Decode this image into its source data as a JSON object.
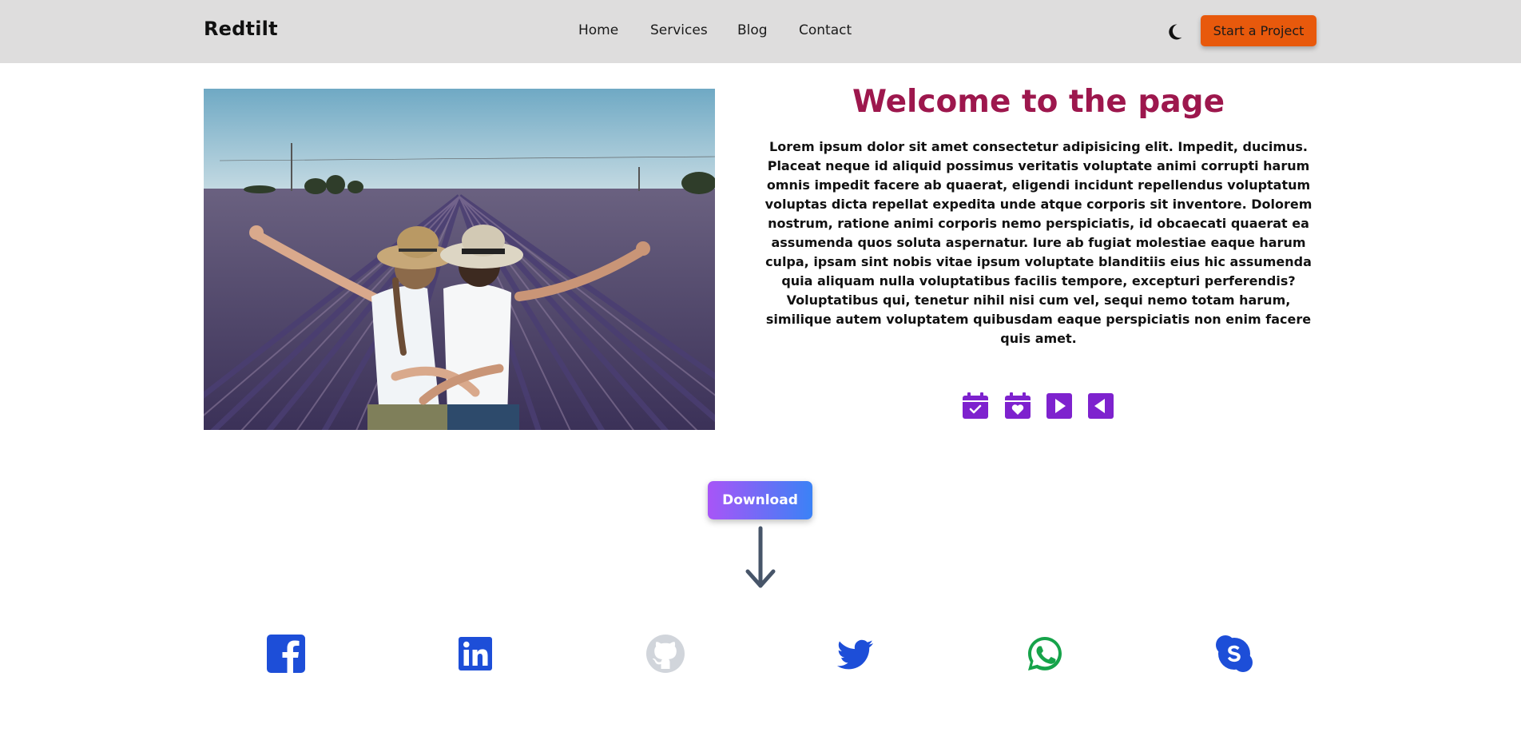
{
  "header": {
    "brand": "Redtilt",
    "nav": [
      "Home",
      "Services",
      "Blog",
      "Contact"
    ],
    "theme_icon": "moon-icon",
    "cta_label": "Start a Project"
  },
  "hero": {
    "title": "Welcome to the page",
    "body": "Lorem ipsum dolor sit amet consectetur adipisicing elit. Impedit, ducimus. Placeat neque id aliquid possimus veritatis voluptate animi corrupti harum omnis impedit facere ab quaerat, eligendi incidunt repellendus voluptatum voluptas dicta repellat expedita unde atque corporis sit inventore. Dolorem nostrum, ratione animi corporis nemo perspiciatis, id obcaecati quaerat ea assumenda quos soluta aspernatur. Iure ab fugiat molestiae eaque harum culpa, ipsam sint nobis vitae ipsum voluptate blanditiis eius hic assumenda quia aliquam nulla voluptatibus facilis tempore, excepturi perferendis? Voluptatibus qui, tenetur nihil nisi cum vel, sequi nemo totam harum, similique autem voluptatem quibusdam eaque perspiciatis non enim facere quis amet.",
    "icons": [
      "calendar-check-icon",
      "calendar-heart-icon",
      "play-right-icon",
      "play-left-icon"
    ]
  },
  "download": {
    "label": "Download"
  },
  "social": [
    "facebook-icon",
    "linkedin-icon",
    "github-icon",
    "twitter-icon",
    "whatsapp-icon",
    "skype-icon"
  ],
  "colors": {
    "navbar_bg": "#dedddd",
    "cta": "#e8590c",
    "title": "#9d174d",
    "icon_purple": "#7e22ce",
    "facebook": "#1d4ed8",
    "linkedin": "#1d4ed8",
    "github": "#d1d5db",
    "twitter": "#1d4ed8",
    "whatsapp": "#16a34a",
    "skype": "#1d4ed8",
    "arrow": "#475569"
  }
}
